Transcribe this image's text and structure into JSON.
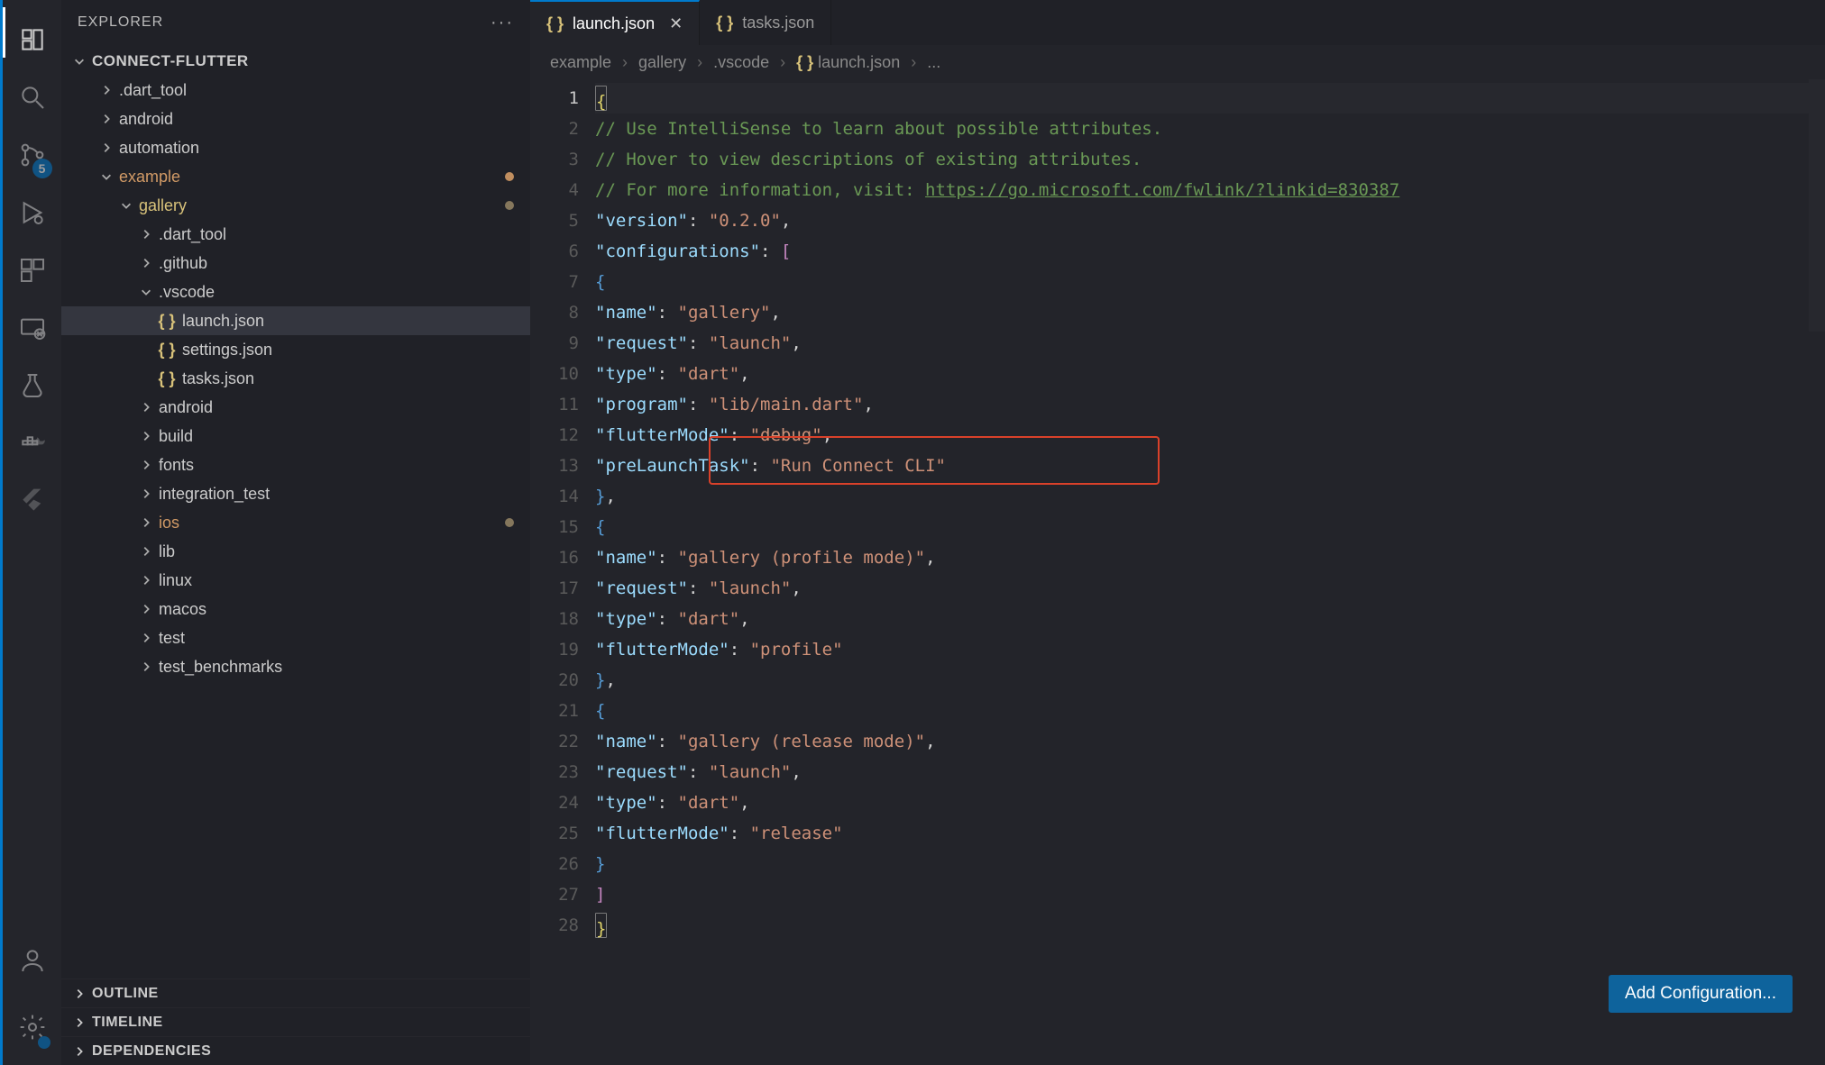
{
  "sidebar": {
    "title": "EXPLORER",
    "root": "CONNECT-FLUTTER",
    "tree": [
      {
        "label": ".dart_tool",
        "depth": 1,
        "chev": "right"
      },
      {
        "label": "android",
        "depth": 1,
        "chev": "right"
      },
      {
        "label": "automation",
        "depth": 1,
        "chev": "right"
      },
      {
        "label": "example",
        "depth": 1,
        "chev": "down",
        "mod": "orange",
        "dot": true
      },
      {
        "label": "gallery",
        "depth": 2,
        "chev": "down",
        "mod": "yellow",
        "dot": "faded"
      },
      {
        "label": ".dart_tool",
        "depth": 3,
        "chev": "right"
      },
      {
        "label": ".github",
        "depth": 3,
        "chev": "right"
      },
      {
        "label": ".vscode",
        "depth": 3,
        "chev": "down"
      },
      {
        "label": "launch.json",
        "depth": 4,
        "file": "braces",
        "selected": true
      },
      {
        "label": "settings.json",
        "depth": 4,
        "file": "braces"
      },
      {
        "label": "tasks.json",
        "depth": 4,
        "file": "braces"
      },
      {
        "label": "android",
        "depth": 3,
        "chev": "right"
      },
      {
        "label": "build",
        "depth": 3,
        "chev": "right"
      },
      {
        "label": "fonts",
        "depth": 3,
        "chev": "right"
      },
      {
        "label": "integration_test",
        "depth": 3,
        "chev": "right"
      },
      {
        "label": "ios",
        "depth": 3,
        "chev": "right",
        "mod": "orange",
        "dot": "faded"
      },
      {
        "label": "lib",
        "depth": 3,
        "chev": "right"
      },
      {
        "label": "linux",
        "depth": 3,
        "chev": "right"
      },
      {
        "label": "macos",
        "depth": 3,
        "chev": "right"
      },
      {
        "label": "test",
        "depth": 3,
        "chev": "right"
      },
      {
        "label": "test_benchmarks",
        "depth": 3,
        "chev": "right"
      }
    ],
    "sections": [
      "OUTLINE",
      "TIMELINE",
      "DEPENDENCIES"
    ]
  },
  "scm_badge": "5",
  "tabs": [
    {
      "label": "launch.json",
      "icon": "braces",
      "active": true,
      "close": true
    },
    {
      "label": "tasks.json",
      "icon": "braces",
      "active": false
    }
  ],
  "breadcrumb": [
    "example",
    "gallery",
    ".vscode",
    "{} launch.json",
    "..."
  ],
  "editor": {
    "line_count": 28,
    "active_line": 1,
    "comments": [
      "// Use IntelliSense to learn about possible attributes.",
      "// Hover to view descriptions of existing attributes.",
      "// For more information, visit: "
    ],
    "comment_url": "https://go.microsoft.com/fwlink/?linkid=830387",
    "version_key": "\"version\"",
    "version_val": "\"0.2.0\"",
    "config_key": "\"configurations\"",
    "configs": [
      {
        "name_k": "\"name\"",
        "name_v": "\"gallery\"",
        "request_k": "\"request\"",
        "request_v": "\"launch\"",
        "type_k": "\"type\"",
        "type_v": "\"dart\"",
        "program_k": "\"program\"",
        "program_v": "\"lib/main.dart\"",
        "mode_k": "\"flutterMode\"",
        "mode_v": "\"debug\"",
        "pre_k": "\"preLaunchTask\"",
        "pre_v": "\"Run Connect CLI\""
      },
      {
        "name_k": "\"name\"",
        "name_v": "\"gallery (profile mode)\"",
        "request_k": "\"request\"",
        "request_v": "\"launch\"",
        "type_k": "\"type\"",
        "type_v": "\"dart\"",
        "mode_k": "\"flutterMode\"",
        "mode_v": "\"profile\""
      },
      {
        "name_k": "\"name\"",
        "name_v": "\"gallery (release mode)\"",
        "request_k": "\"request\"",
        "request_v": "\"launch\"",
        "type_k": "\"type\"",
        "type_v": "\"dart\"",
        "mode_k": "\"flutterMode\"",
        "mode_v": "\"release\""
      }
    ],
    "button": "Add Configuration..."
  }
}
